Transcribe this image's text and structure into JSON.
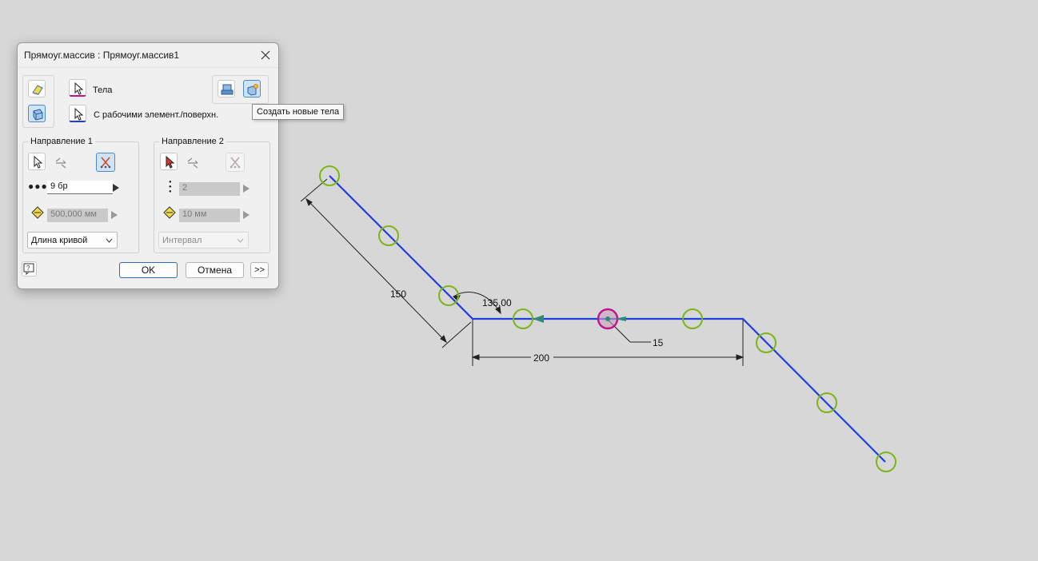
{
  "dialog": {
    "title": "Прямоуг.массив : Прямоуг.массив1",
    "bodies_label": "Тела",
    "work_features_label": "С рабочими элемент./поверхн.",
    "tooltip": "Создать новые тела",
    "direction1": {
      "legend": "Направление 1",
      "count": "9 бр",
      "spacing": "500,000 мм",
      "method": "Длина кривой"
    },
    "direction2": {
      "legend": "Направление 2",
      "count": "2",
      "spacing": "10 мм",
      "method": "Интервал"
    },
    "ok_label": "OK",
    "cancel_label": "Отмена",
    "more_label": ">>"
  },
  "sketch": {
    "dimensions": {
      "length_1": "150",
      "angle": "135,00",
      "length_2": "200",
      "circle": "15"
    },
    "colors": {
      "path": "#1f3fe0",
      "instance_circle": "#7cb518",
      "selected_circle": "#c0148c"
    }
  }
}
